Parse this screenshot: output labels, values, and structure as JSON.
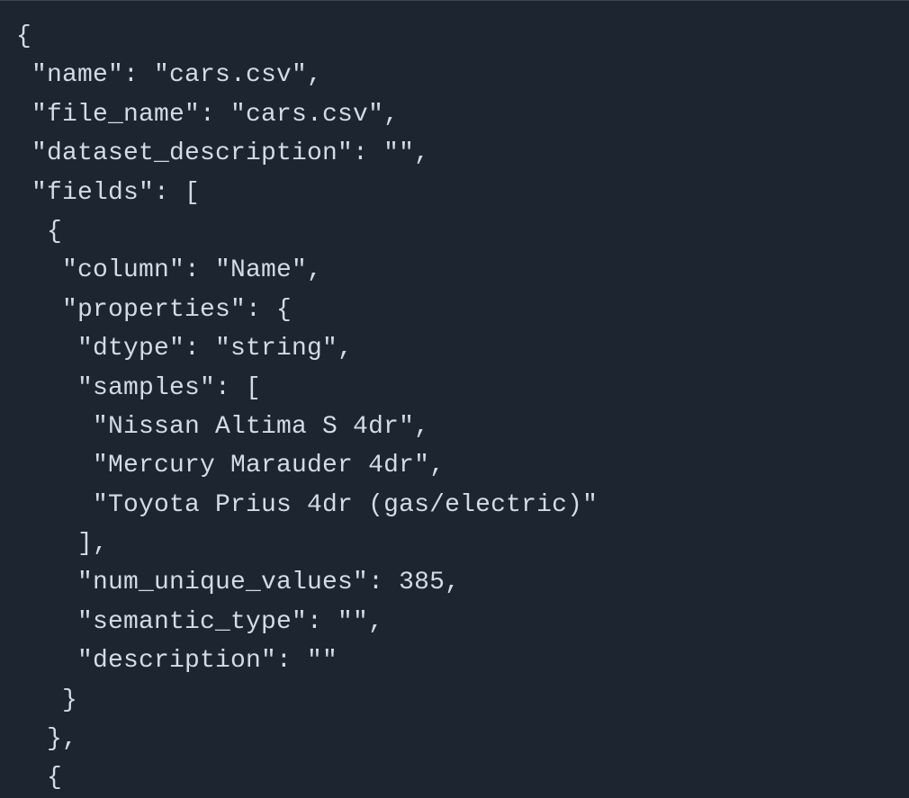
{
  "code": {
    "lines": [
      "{",
      " \"name\": \"cars.csv\",",
      " \"file_name\": \"cars.csv\",",
      " \"dataset_description\": \"\",",
      " \"fields\": [",
      "  {",
      "   \"column\": \"Name\",",
      "   \"properties\": {",
      "    \"dtype\": \"string\",",
      "    \"samples\": [",
      "     \"Nissan Altima S 4dr\",",
      "     \"Mercury Marauder 4dr\",",
      "     \"Toyota Prius 4dr (gas/electric)\"",
      "    ],",
      "    \"num_unique_values\": 385,",
      "    \"semantic_type\": \"\",",
      "    \"description\": \"\"",
      "   }",
      "  },",
      "  {"
    ]
  }
}
